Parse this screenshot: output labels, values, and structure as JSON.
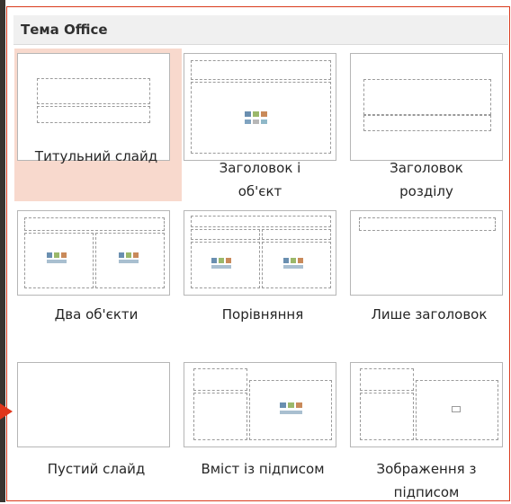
{
  "panel": {
    "title": "Тема Office"
  },
  "layouts": [
    {
      "label": "Титульний слайд",
      "selected": true
    },
    {
      "label": "Заголовок і об'єкт",
      "selected": false
    },
    {
      "label": "Заголовок розділу",
      "selected": false
    },
    {
      "label": "Два об'єкти",
      "selected": false
    },
    {
      "label": "Порівняння",
      "selected": false
    },
    {
      "label": "Лише заголовок",
      "selected": false
    },
    {
      "label": "Пустий слайд",
      "selected": false
    },
    {
      "label": "Вміст із підписом",
      "selected": false
    },
    {
      "label": "Зображення з підписом",
      "selected": false
    }
  ],
  "colors": {
    "accent": "#e0351a",
    "selection": "#f8d9cd",
    "header_bg": "#f0f0f0"
  }
}
